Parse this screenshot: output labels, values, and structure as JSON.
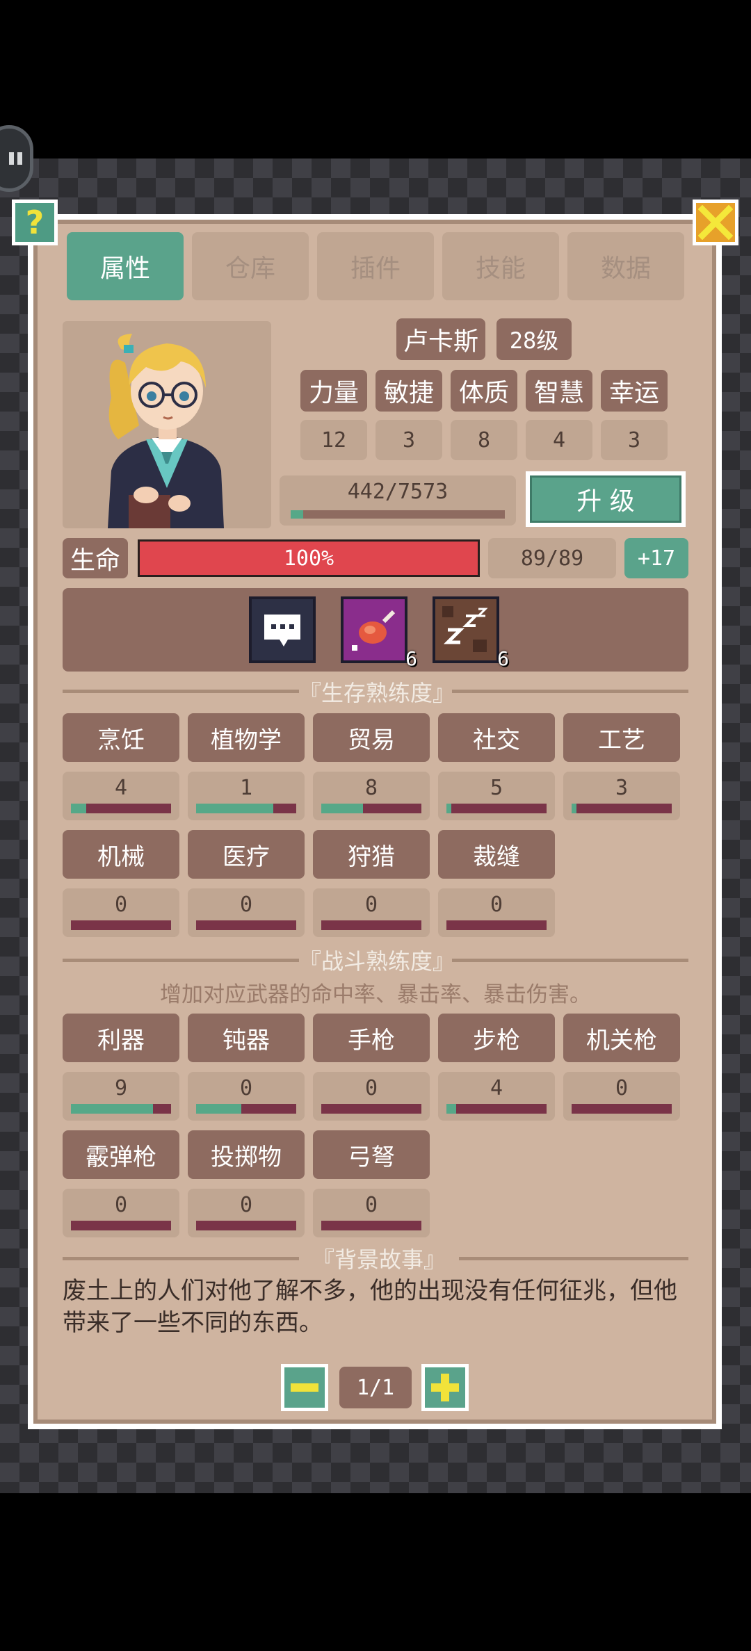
{
  "tabs": [
    {
      "label": "属性",
      "active": true
    },
    {
      "label": "仓库",
      "active": false
    },
    {
      "label": "插件",
      "active": false
    },
    {
      "label": "技能",
      "active": false
    },
    {
      "label": "数据",
      "active": false
    }
  ],
  "character": {
    "name": "卢卡斯",
    "level": "28级"
  },
  "attributes": [
    {
      "label": "力量",
      "value": "12"
    },
    {
      "label": "敏捷",
      "value": "3"
    },
    {
      "label": "体质",
      "value": "8"
    },
    {
      "label": "智慧",
      "value": "4"
    },
    {
      "label": "幸运",
      "value": "3"
    }
  ],
  "experience": {
    "text": "442/7573",
    "fraction": 0.058
  },
  "level_up_label": "升 级",
  "health": {
    "label": "生命",
    "percent_text": "100%",
    "fraction": 1.0,
    "value_text": "89/89",
    "regen": "+17"
  },
  "status_effects": [
    {
      "icon": "speech-bubble-icon",
      "count": ""
    },
    {
      "icon": "meat-icon",
      "count": "6"
    },
    {
      "icon": "sleep-icon",
      "count": "6"
    }
  ],
  "survival": {
    "title": "『生存熟练度』",
    "skills": [
      {
        "name": "烹饪",
        "value": "4",
        "fraction": 0.15
      },
      {
        "name": "植物学",
        "value": "1",
        "fraction": 0.77
      },
      {
        "name": "贸易",
        "value": "8",
        "fraction": 0.42
      },
      {
        "name": "社交",
        "value": "5",
        "fraction": 0.05
      },
      {
        "name": "工艺",
        "value": "3",
        "fraction": 0.05
      },
      {
        "name": "机械",
        "value": "0",
        "fraction": 0.0
      },
      {
        "name": "医疗",
        "value": "0",
        "fraction": 0.0
      },
      {
        "name": "狩猎",
        "value": "0",
        "fraction": 0.0
      },
      {
        "name": "裁缝",
        "value": "0",
        "fraction": 0.0
      }
    ]
  },
  "combat": {
    "title": "『战斗熟练度』",
    "description": "增加对应武器的命中率、暴击率、暴击伤害。",
    "skills": [
      {
        "name": "利器",
        "value": "9",
        "fraction": 0.82
      },
      {
        "name": "钝器",
        "value": "0",
        "fraction": 0.45
      },
      {
        "name": "手枪",
        "value": "0",
        "fraction": 0.0
      },
      {
        "name": "步枪",
        "value": "4",
        "fraction": 0.1
      },
      {
        "name": "机关枪",
        "value": "0",
        "fraction": 0.0
      },
      {
        "name": "霰弹枪",
        "value": "0",
        "fraction": 0.0
      },
      {
        "name": "投掷物",
        "value": "0",
        "fraction": 0.0
      },
      {
        "name": "弓弩",
        "value": "0",
        "fraction": 0.0
      }
    ]
  },
  "backstory": {
    "title": "『背景故事』",
    "text": "废土上的人们对他了解不多，他的出现没有任何征兆，但他带来了一些不同的东西。"
  },
  "pagination": {
    "text": "1/1"
  },
  "colors": {
    "panel": "#cfb4a0",
    "accent": "#5aa38b",
    "health": "#e0464e",
    "dark_box": "#8e6b60"
  }
}
